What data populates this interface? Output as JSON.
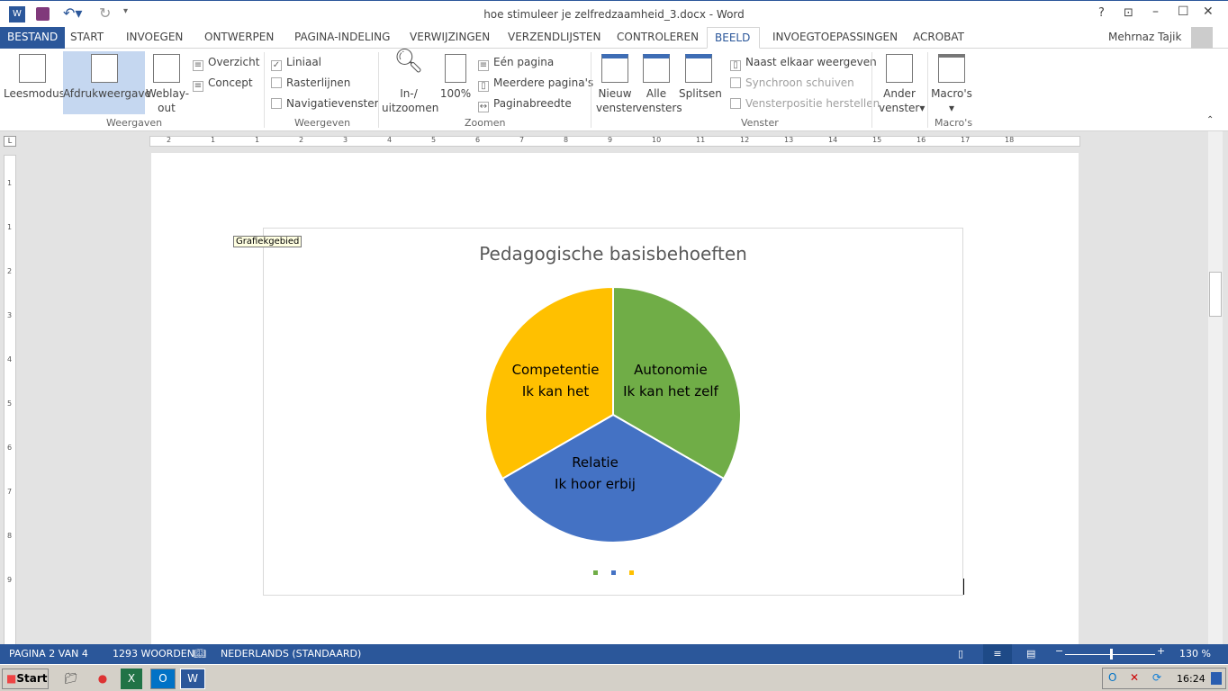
{
  "window": {
    "title": "hoe stimuleer je zelfredzaamheid_3.docx - Word",
    "help": "?",
    "user": "Mehrnaz Tajik"
  },
  "tabs": [
    "BESTAND",
    "START",
    "INVOEGEN",
    "ONTWERPEN",
    "PAGINA-INDELING",
    "VERWIJZINGEN",
    "VERZENDLIJSTEN",
    "CONTROLEREN",
    "BEELD",
    "INVOEGTOEPASSINGEN",
    "ACROBAT"
  ],
  "ribbon": {
    "weergaven": {
      "label": "Weergaven",
      "leesmodus": "Leesmodus",
      "afdruk": "Afdrukweergave",
      "web1": "Weblay-",
      "web2": "out",
      "overzicht": "Overzicht",
      "concept": "Concept"
    },
    "weergeven": {
      "label": "Weergeven",
      "liniaal": "Liniaal",
      "raster": "Rasterlijnen",
      "nav": "Navigatievenster",
      "liniaal_checked": true
    },
    "zoomen": {
      "label": "Zoomen",
      "in1": "In-/",
      "in2": "uitzoomen",
      "p100": "100%",
      "een": "Eén pagina",
      "meer": "Meerdere pagina's",
      "breedte": "Paginabreedte"
    },
    "venster": {
      "label": "Venster",
      "nieuw1": "Nieuw",
      "nieuw2": "venster",
      "alle1": "Alle",
      "alle2": "vensters",
      "splitsen": "Splitsen",
      "naast": "Naast elkaar weergeven",
      "sync": "Synchroon schuiven",
      "herstel": "Vensterpositie herstellen",
      "ander1": "Ander",
      "ander2": "venster"
    },
    "macros": {
      "label": "Macro's",
      "btn": "Macro's"
    }
  },
  "ruler": {
    "h": [
      "2",
      "1",
      "1",
      "2",
      "3",
      "4",
      "5",
      "6",
      "7",
      "8",
      "9",
      "10",
      "11",
      "12",
      "13",
      "14",
      "15",
      "16",
      "17",
      "18"
    ],
    "v": [
      "1",
      "1",
      "2",
      "3",
      "4",
      "5",
      "6",
      "7",
      "8",
      "9"
    ]
  },
  "tooltip": "Grafiekgebied",
  "chart_data": {
    "type": "pie",
    "title": "Pedagogische basisbehoeften",
    "slices": [
      {
        "label": "Autonomie",
        "sublabel": "Ik kan het zelf",
        "value": 1,
        "color": "#70ad47"
      },
      {
        "label": "Relatie",
        "sublabel": "Ik hoor erbij",
        "value": 1,
        "color": "#4472c4"
      },
      {
        "label": "Competentie",
        "sublabel": "Ik kan het",
        "value": 1,
        "color": "#ffc000"
      }
    ],
    "legend": "bottom"
  },
  "status": {
    "page": "PAGINA 2 VAN 4",
    "words": "1293 WOORDEN",
    "lang": "NEDERLANDS (STANDAARD)",
    "zoom": "130 %",
    "zoom_percent": 130
  },
  "taskbar": {
    "start": "Start",
    "time": "16:24"
  }
}
